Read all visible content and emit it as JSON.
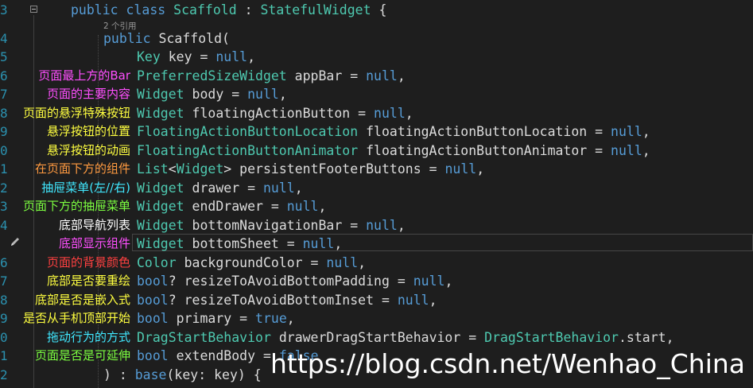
{
  "editor": {
    "codelens": "2 个引用",
    "watermark": "https://blog.csdn.net/Wenhao_China",
    "lines": [
      {
        "num": "3",
        "ann": "",
        "ann_color": "",
        "tokens": [
          {
            "t": "public ",
            "c": "kw"
          },
          {
            "t": "class ",
            "c": "kw"
          },
          {
            "t": "Scaffold",
            "c": "ty"
          },
          {
            "t": " : ",
            "c": "op"
          },
          {
            "t": "StatefulWidget",
            "c": "ty"
          },
          {
            "t": " {",
            "c": "op"
          }
        ]
      },
      {
        "num": "4",
        "ann": "",
        "ann_color": "",
        "tokens": [
          {
            "t": "public ",
            "c": "kw"
          },
          {
            "t": "Scaffold(",
            "c": "op"
          }
        ]
      },
      {
        "num": "5",
        "ann": "",
        "ann_color": "",
        "tokens": [
          {
            "t": "Key",
            "c": "ty"
          },
          {
            "t": " key = ",
            "c": "op"
          },
          {
            "t": "null",
            "c": "lit"
          },
          {
            "t": ",",
            "c": "op"
          }
        ]
      },
      {
        "num": "6",
        "ann": "页面最上方的Bar",
        "ann_color": "#ff4fff",
        "tokens": [
          {
            "t": "PreferredSizeWidget",
            "c": "ty"
          },
          {
            "t": " appBar = ",
            "c": "op"
          },
          {
            "t": "null",
            "c": "lit"
          },
          {
            "t": ",",
            "c": "op"
          }
        ]
      },
      {
        "num": "7",
        "ann": "页面的主要内容",
        "ann_color": "#ff4fff",
        "tokens": [
          {
            "t": "Widget",
            "c": "ty"
          },
          {
            "t": " body = ",
            "c": "op"
          },
          {
            "t": "null",
            "c": "lit"
          },
          {
            "t": ",",
            "c": "op"
          }
        ]
      },
      {
        "num": "8",
        "ann": "页面的悬浮特殊按钮",
        "ann_color": "#ffff40",
        "tokens": [
          {
            "t": "Widget",
            "c": "ty"
          },
          {
            "t": " floatingActionButton = ",
            "c": "op"
          },
          {
            "t": "null",
            "c": "lit"
          },
          {
            "t": ",",
            "c": "op"
          }
        ]
      },
      {
        "num": "9",
        "ann": "悬浮按钮的位置",
        "ann_color": "#ffff40",
        "tokens": [
          {
            "t": "FloatingActionButtonLocation",
            "c": "ty"
          },
          {
            "t": " floatingActionButtonLocation = ",
            "c": "op"
          },
          {
            "t": "null",
            "c": "lit"
          },
          {
            "t": ",",
            "c": "op"
          }
        ]
      },
      {
        "num": "0",
        "ann": "悬浮按钮的动画",
        "ann_color": "#ffff40",
        "tokens": [
          {
            "t": "FloatingActionButtonAnimator",
            "c": "ty"
          },
          {
            "t": " floatingActionButtonAnimator = ",
            "c": "op"
          },
          {
            "t": "null",
            "c": "lit"
          },
          {
            "t": ",",
            "c": "op"
          }
        ]
      },
      {
        "num": "1",
        "ann": "在页面下方的组件",
        "ann_color": "#ff9a40",
        "tokens": [
          {
            "t": "List",
            "c": "ty"
          },
          {
            "t": "<",
            "c": "op"
          },
          {
            "t": "Widget",
            "c": "ty"
          },
          {
            "t": "> persistentFooterButtons = ",
            "c": "op"
          },
          {
            "t": "null",
            "c": "lit"
          },
          {
            "t": ",",
            "c": "op"
          }
        ]
      },
      {
        "num": "2",
        "ann": "抽屉菜单(左//右)",
        "ann_color": "#40e8ff",
        "tokens": [
          {
            "t": "Widget",
            "c": "ty"
          },
          {
            "t": " drawer = ",
            "c": "op"
          },
          {
            "t": "null",
            "c": "lit"
          },
          {
            "t": ",",
            "c": "op"
          }
        ]
      },
      {
        "num": "3",
        "ann": "页面下方的抽屉菜单",
        "ann_color": "#7cff40",
        "tokens": [
          {
            "t": "Widget",
            "c": "ty"
          },
          {
            "t": " endDrawer = ",
            "c": "op"
          },
          {
            "t": "null",
            "c": "lit"
          },
          {
            "t": ",",
            "c": "op"
          }
        ]
      },
      {
        "num": "4",
        "ann": "底部导航列表",
        "ann_color": "#ffffff",
        "tokens": [
          {
            "t": "Widget",
            "c": "ty"
          },
          {
            "t": " bottomNavigationBar = ",
            "c": "op"
          },
          {
            "t": "null",
            "c": "lit"
          },
          {
            "t": ",",
            "c": "op"
          }
        ]
      },
      {
        "num": "",
        "ann": "底部显示组件",
        "ann_color": "#ff4fff",
        "tokens": [
          {
            "t": "Widget",
            "c": "ty"
          },
          {
            "t": " bottomSheet = ",
            "c": "op"
          },
          {
            "t": "null",
            "c": "lit"
          },
          {
            "t": ",",
            "c": "op"
          }
        ]
      },
      {
        "num": "6",
        "ann": "页面的背景颜色",
        "ann_color": "#ff4040",
        "tokens": [
          {
            "t": "Color",
            "c": "ty"
          },
          {
            "t": " backgroundColor = ",
            "c": "op"
          },
          {
            "t": "null",
            "c": "lit"
          },
          {
            "t": ",",
            "c": "op"
          }
        ]
      },
      {
        "num": "7",
        "ann": "底部是否要重绘",
        "ann_color": "#ffff40",
        "tokens": [
          {
            "t": "bool",
            "c": "kw"
          },
          {
            "t": "? resizeToAvoidBottomPadding = ",
            "c": "op"
          },
          {
            "t": "null",
            "c": "lit"
          },
          {
            "t": ",",
            "c": "op"
          }
        ]
      },
      {
        "num": "8",
        "ann": "底部是否是嵌入式",
        "ann_color": "#ffff40",
        "tokens": [
          {
            "t": "bool",
            "c": "kw"
          },
          {
            "t": "? resizeToAvoidBottomInset = ",
            "c": "op"
          },
          {
            "t": "null",
            "c": "lit"
          },
          {
            "t": ",",
            "c": "op"
          }
        ]
      },
      {
        "num": "9",
        "ann": "是否从手机顶部开始",
        "ann_color": "#ffff40",
        "tokens": [
          {
            "t": "bool",
            "c": "kw"
          },
          {
            "t": " primary = ",
            "c": "op"
          },
          {
            "t": "true",
            "c": "lit"
          },
          {
            "t": ",",
            "c": "op"
          }
        ]
      },
      {
        "num": "0",
        "ann": "拖动行为的方式",
        "ann_color": "#40e8ff",
        "tokens": [
          {
            "t": "DragStartBehavior",
            "c": "ty"
          },
          {
            "t": " drawerDragStartBehavior = ",
            "c": "op"
          },
          {
            "t": "DragStartBehavior",
            "c": "ty"
          },
          {
            "t": ".start,",
            "c": "op"
          }
        ]
      },
      {
        "num": "1",
        "ann": "页面是否是可延伸",
        "ann_color": "#7cff40",
        "tokens": [
          {
            "t": "bool",
            "c": "kw"
          },
          {
            "t": " extendBody = ",
            "c": "op"
          },
          {
            "t": "false",
            "c": "lit"
          }
        ]
      },
      {
        "num": "2",
        "ann": "",
        "ann_color": "",
        "tokens": [
          {
            "t": ") : ",
            "c": "op"
          },
          {
            "t": "base",
            "c": "kw"
          },
          {
            "t": "(key: key) {",
            "c": "op"
          }
        ]
      }
    ]
  }
}
